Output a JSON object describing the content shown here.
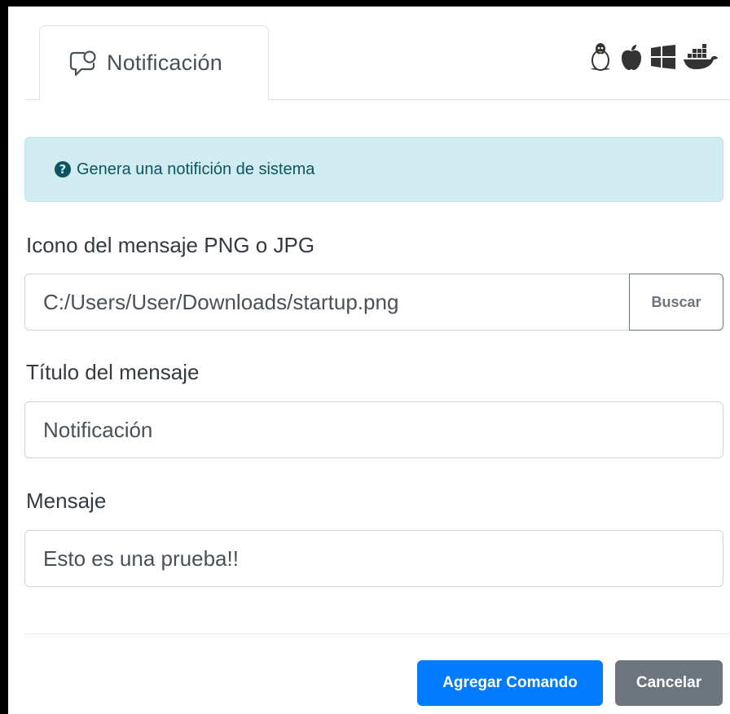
{
  "tab": {
    "label": "Notificación",
    "icon": "speech-bubble-icon"
  },
  "os_icons": [
    "linux-icon",
    "apple-icon",
    "windows-icon",
    "docker-icon"
  ],
  "alert": {
    "icon": "question-circle-icon",
    "text": "Genera una notifición de sistema"
  },
  "form": {
    "icon_field": {
      "label": "Icono del mensaje PNG o JPG",
      "value": "C:/Users/User/Downloads/startup.png",
      "browse_label": "Buscar"
    },
    "title_field": {
      "label": "Título del mensaje",
      "value": "Notificación"
    },
    "message_field": {
      "label": "Mensaje",
      "value": "Esto es una prueba!!"
    }
  },
  "footer": {
    "add_command_label": "Agregar Comando",
    "cancel_label": "Cancelar"
  },
  "colors": {
    "primary": "#007bff",
    "secondary": "#6c757d",
    "info_bg": "#d1ecf1",
    "info_text": "#0c5460"
  }
}
